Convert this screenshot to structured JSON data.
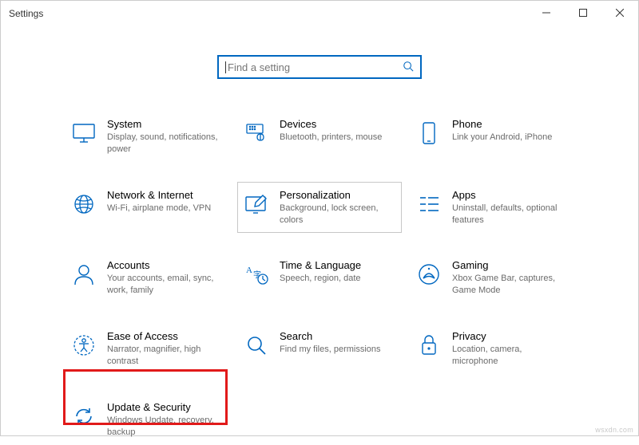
{
  "window": {
    "title": "Settings"
  },
  "search": {
    "placeholder": "Find a setting"
  },
  "tiles": {
    "system": {
      "title": "System",
      "desc": "Display, sound, notifications, power"
    },
    "devices": {
      "title": "Devices",
      "desc": "Bluetooth, printers, mouse"
    },
    "phone": {
      "title": "Phone",
      "desc": "Link your Android, iPhone"
    },
    "network": {
      "title": "Network & Internet",
      "desc": "Wi-Fi, airplane mode, VPN"
    },
    "personalization": {
      "title": "Personalization",
      "desc": "Background, lock screen, colors"
    },
    "apps": {
      "title": "Apps",
      "desc": "Uninstall, defaults, optional features"
    },
    "accounts": {
      "title": "Accounts",
      "desc": "Your accounts, email, sync, work, family"
    },
    "time": {
      "title": "Time & Language",
      "desc": "Speech, region, date"
    },
    "gaming": {
      "title": "Gaming",
      "desc": "Xbox Game Bar, captures, Game Mode"
    },
    "ease": {
      "title": "Ease of Access",
      "desc": "Narrator, magnifier, high contrast"
    },
    "search_tile": {
      "title": "Search",
      "desc": "Find my files, permissions"
    },
    "privacy": {
      "title": "Privacy",
      "desc": "Location, camera, microphone"
    },
    "update": {
      "title": "Update & Security",
      "desc": "Windows Update, recovery, backup"
    }
  },
  "watermark": "wsxdn.com"
}
